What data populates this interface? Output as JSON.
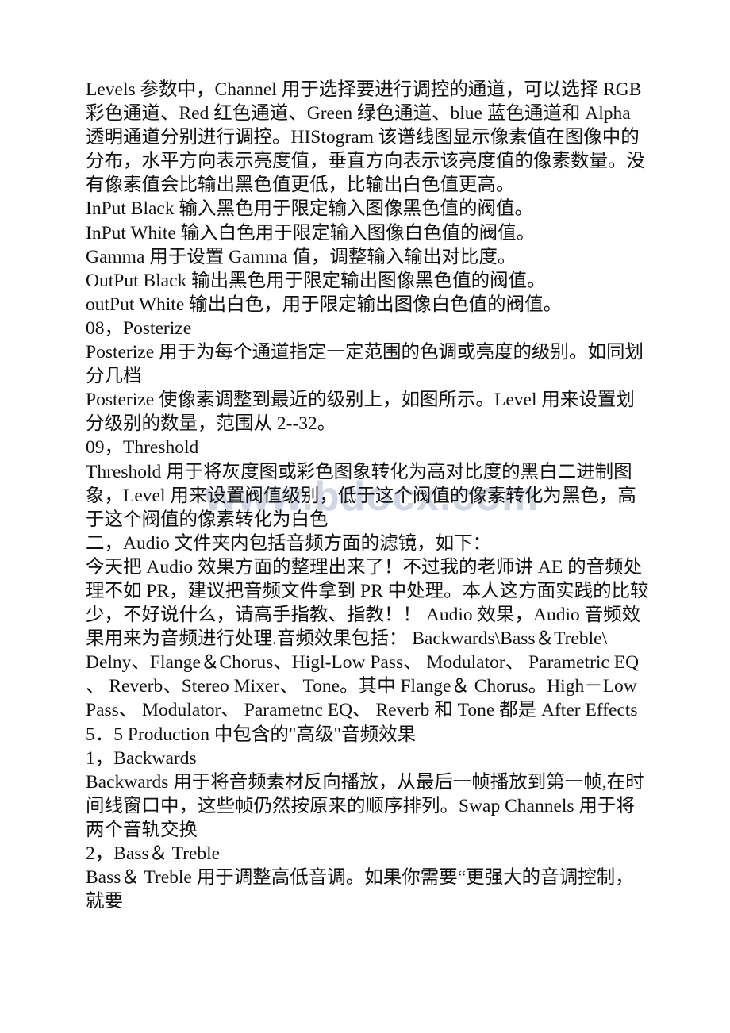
{
  "document": {
    "page_background": "#ffffff",
    "text_color": "#111111",
    "watermark": {
      "text": "www.bdocx.com",
      "color": "#c9cfe0"
    },
    "lines": [
      "Levels 参数中，Channel 用于选择要进行调控的通道，可以选择 RGB",
      "彩色通道、Red 红色通道、Green 绿色通道、blue 蓝色通道和 Alpha",
      "透明通道分别进行调控。HIStogram 该谱线图显示像素值在图像中的",
      "分布，水平方向表示亮度值，垂直方向表示该亮度值的像素数量。没",
      "有像素值会比输出黑色值更低，比输出白色值更高。",
      "InPut Black 输入黑色用于限定输入图像黑色值的阀值。",
      "InPut White 输入白色用于限定输入图像白色值的阀值。",
      "Gamma 用于设置 Gamma 值，调整输入输出对比度。",
      "OutPut Black 输出黑色用于限定输出图像黑色值的阀值。",
      "outPut White 输出白色，用于限定输出图像白色值的阀值。",
      "08，Posterize",
      "Posterize 用于为每个通道指定一定范围的色调或亮度的级别。如同划",
      "分几档",
      "Posterize 使像素调整到最近的级别上，如图所示。Level 用来设置划",
      "分级别的数量，范围从 2--32。",
      "09，Threshold",
      "Threshold 用于将灰度图或彩色图象转化为高对比度的黑白二进制图",
      "象，Level 用来设置阀值级别，低于这个阀值的像素转化为黑色，高",
      "于这个阀值的像素转化为白色",
      "二，Audio 文件夹内包括音频方面的滤镜，如下：",
      "今天把 Audio 效果方面的整理出来了！不过我的老师讲 AE 的音频处",
      "理不如 PR，建议把音频文件拿到 PR 中处理。本人这方面实践的比较",
      "少，不好说什么，请高手指教、指教！！ Audio 效果，Audio 音频效",
      "果用来为音频进行处理.音频效果包括： Backwards\\Bass＆Treble\\",
      "Delny、Flange＆Chorus、Higl-Low Pass、 Modulator、 Parametric EQ",
      "、 Reverb、Stereo Mixer、 Tone。其中 Flange＆ Chorus。High－Low",
      "Pass、 Modulator、 Parametnc EQ、 Reverb 和 Tone 都是 After Effects",
      "5．5 Production 中包含的\"高级\"音频效果",
      "1，Backwards",
      "Backwards 用于将音频素材反向播放，从最后一帧播放到第一帧,在时",
      "间线窗口中，这些帧仍然按原来的顺序排列。Swap Channels 用于将",
      "两个音轨交换",
      "2，Bass＆ Treble",
      "Bass＆ Treble 用于调整高低音调。如果你需要“更强大的音调控制，",
      "就要"
    ]
  }
}
